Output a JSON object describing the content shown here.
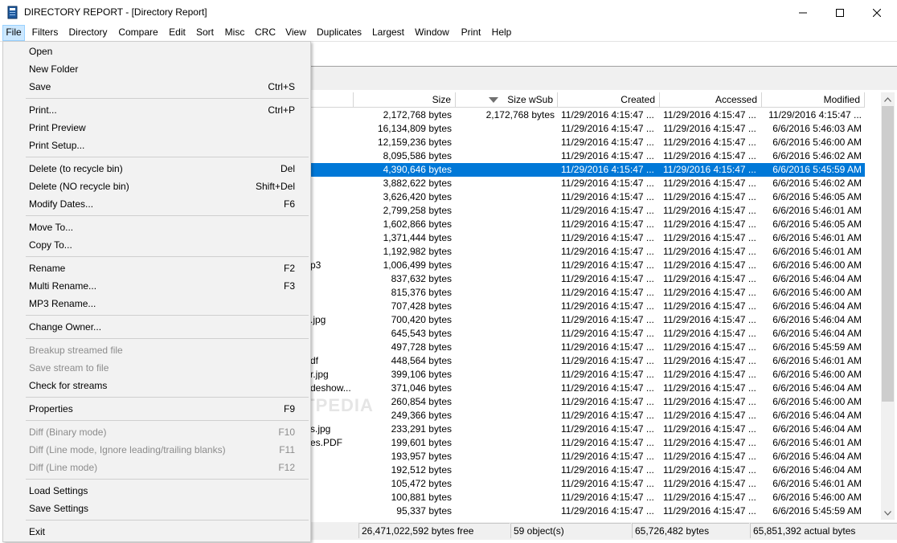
{
  "window": {
    "title": "DIRECTORY REPORT - [Directory Report]",
    "icons": {
      "app": "book-icon",
      "minimize": "minimize-icon",
      "maximize": "maximize-icon",
      "close": "close-icon"
    }
  },
  "menubar": {
    "items": [
      "File",
      "Filters",
      "Directory",
      "Compare",
      "Edit",
      "Sort",
      "Misc",
      "CRC",
      "View",
      "Duplicates",
      "Largest",
      "Window",
      "Print",
      "Help"
    ],
    "active": "File"
  },
  "file_menu": {
    "items": [
      {
        "label": "Open",
        "shortcut": "",
        "disabled": false
      },
      {
        "label": "New Folder",
        "shortcut": "",
        "disabled": false
      },
      {
        "label": "Save",
        "shortcut": "Ctrl+S",
        "disabled": false
      },
      {
        "label": "Print...",
        "shortcut": "Ctrl+P",
        "disabled": false
      },
      {
        "label": "Print Preview",
        "shortcut": "",
        "disabled": false
      },
      {
        "label": "Print Setup...",
        "shortcut": "",
        "disabled": false
      },
      {
        "label": "Delete (to recycle bin)",
        "shortcut": "Del",
        "disabled": false
      },
      {
        "label": "Delete  (NO recycle bin)",
        "shortcut": "Shift+Del",
        "disabled": false
      },
      {
        "label": "Modify Dates...",
        "shortcut": "F6",
        "disabled": false
      },
      {
        "label": "Move To...",
        "shortcut": "",
        "disabled": false
      },
      {
        "label": "Copy To...",
        "shortcut": "",
        "disabled": false
      },
      {
        "label": "Rename",
        "shortcut": "F2",
        "disabled": false
      },
      {
        "label": "Multi Rename...",
        "shortcut": "F3",
        "disabled": false
      },
      {
        "label": "MP3 Rename...",
        "shortcut": "",
        "disabled": false
      },
      {
        "label": "Change Owner...",
        "shortcut": "",
        "disabled": false
      },
      {
        "label": "Breakup streamed file",
        "shortcut": "",
        "disabled": true
      },
      {
        "label": "Save stream to file",
        "shortcut": "",
        "disabled": true
      },
      {
        "label": "Check for streams",
        "shortcut": "",
        "disabled": false
      },
      {
        "label": "Properties",
        "shortcut": "F9",
        "disabled": false
      },
      {
        "label": "Diff (Binary mode)",
        "shortcut": "F10",
        "disabled": true
      },
      {
        "label": "Diff (Line mode, Ignore leading/trailing blanks)",
        "shortcut": "F11",
        "disabled": true
      },
      {
        "label": "Diff (Line mode)",
        "shortcut": "F12",
        "disabled": true
      },
      {
        "label": "Load Settings",
        "shortcut": "",
        "disabled": false
      },
      {
        "label": "Save Settings",
        "shortcut": "",
        "disabled": false
      },
      {
        "label": "Exit",
        "shortcut": "",
        "disabled": false
      }
    ]
  },
  "list": {
    "columns": [
      "Size",
      "Size wSub",
      "Created",
      "Accessed",
      "Modified"
    ],
    "sort_icon": "sort-descending-icon",
    "rows": [
      {
        "name": "",
        "size": "2,172,768 bytes",
        "size_wsub": "2,172,768 bytes",
        "created": "11/29/2016 4:15:47 ...",
        "accessed": "11/29/2016 4:15:47 ...",
        "modified": "11/29/2016 4:15:47 ..."
      },
      {
        "name": "",
        "size": "16,134,809 bytes",
        "size_wsub": "",
        "created": "11/29/2016 4:15:47 ...",
        "accessed": "11/29/2016 4:15:47 ...",
        "modified": "6/6/2016 5:46:03 AM"
      },
      {
        "name": "",
        "size": "12,159,236 bytes",
        "size_wsub": "",
        "created": "11/29/2016 4:15:47 ...",
        "accessed": "11/29/2016 4:15:47 ...",
        "modified": "6/6/2016 5:46:00 AM"
      },
      {
        "name": "",
        "size": "8,095,586 bytes",
        "size_wsub": "",
        "created": "11/29/2016 4:15:47 ...",
        "accessed": "11/29/2016 4:15:47 ...",
        "modified": "6/6/2016 5:46:02 AM"
      },
      {
        "name": "",
        "size": "4,390,646 bytes",
        "size_wsub": "",
        "created": "11/29/2016 4:15:47 ...",
        "accessed": "11/29/2016 4:15:47 ...",
        "modified": "6/6/2016 5:45:59 AM",
        "selected": true
      },
      {
        "name": "",
        "size": "3,882,622 bytes",
        "size_wsub": "",
        "created": "11/29/2016 4:15:47 ...",
        "accessed": "11/29/2016 4:15:47 ...",
        "modified": "6/6/2016 5:46:02 AM"
      },
      {
        "name": "",
        "size": "3,626,420 bytes",
        "size_wsub": "",
        "created": "11/29/2016 4:15:47 ...",
        "accessed": "11/29/2016 4:15:47 ...",
        "modified": "6/6/2016 5:46:05 AM"
      },
      {
        "name": "",
        "size": "2,799,258 bytes",
        "size_wsub": "",
        "created": "11/29/2016 4:15:47 ...",
        "accessed": "11/29/2016 4:15:47 ...",
        "modified": "6/6/2016 5:46:01 AM"
      },
      {
        "name": "",
        "size": "1,602,866 bytes",
        "size_wsub": "",
        "created": "11/29/2016 4:15:47 ...",
        "accessed": "11/29/2016 4:15:47 ...",
        "modified": "6/6/2016 5:46:05 AM"
      },
      {
        "name": "",
        "size": "1,371,444 bytes",
        "size_wsub": "",
        "created": "11/29/2016 4:15:47 ...",
        "accessed": "11/29/2016 4:15:47 ...",
        "modified": "6/6/2016 5:46:01 AM"
      },
      {
        "name": "",
        "size": "1,192,982 bytes",
        "size_wsub": "",
        "created": "11/29/2016 4:15:47 ...",
        "accessed": "11/29/2016 4:15:47 ...",
        "modified": "6/6/2016 5:46:01 AM"
      },
      {
        "name": "p3",
        "size": "1,006,499 bytes",
        "size_wsub": "",
        "created": "11/29/2016 4:15:47 ...",
        "accessed": "11/29/2016 4:15:47 ...",
        "modified": "6/6/2016 5:46:00 AM"
      },
      {
        "name": "",
        "size": "837,632 bytes",
        "size_wsub": "",
        "created": "11/29/2016 4:15:47 ...",
        "accessed": "11/29/2016 4:15:47 ...",
        "modified": "6/6/2016 5:46:04 AM"
      },
      {
        "name": "",
        "size": "815,376 bytes",
        "size_wsub": "",
        "created": "11/29/2016 4:15:47 ...",
        "accessed": "11/29/2016 4:15:47 ...",
        "modified": "6/6/2016 5:46:00 AM"
      },
      {
        "name": "",
        "size": "707,428 bytes",
        "size_wsub": "",
        "created": "11/29/2016 4:15:47 ...",
        "accessed": "11/29/2016 4:15:47 ...",
        "modified": "6/6/2016 5:46:04 AM"
      },
      {
        "name": ".jpg",
        "size": "700,420 bytes",
        "size_wsub": "",
        "created": "11/29/2016 4:15:47 ...",
        "accessed": "11/29/2016 4:15:47 ...",
        "modified": "6/6/2016 5:46:04 AM"
      },
      {
        "name": "",
        "size": "645,543 bytes",
        "size_wsub": "",
        "created": "11/29/2016 4:15:47 ...",
        "accessed": "11/29/2016 4:15:47 ...",
        "modified": "6/6/2016 5:46:04 AM"
      },
      {
        "name": "",
        "size": "497,728 bytes",
        "size_wsub": "",
        "created": "11/29/2016 4:15:47 ...",
        "accessed": "11/29/2016 4:15:47 ...",
        "modified": "6/6/2016 5:45:59 AM"
      },
      {
        "name": "df",
        "size": "448,564 bytes",
        "size_wsub": "",
        "created": "11/29/2016 4:15:47 ...",
        "accessed": "11/29/2016 4:15:47 ...",
        "modified": "6/6/2016 5:46:01 AM"
      },
      {
        "name": "r.jpg",
        "size": "399,106 bytes",
        "size_wsub": "",
        "created": "11/29/2016 4:15:47 ...",
        "accessed": "11/29/2016 4:15:47 ...",
        "modified": "6/6/2016 5:46:00 AM"
      },
      {
        "name": "deshow...",
        "size": "371,046 bytes",
        "size_wsub": "",
        "created": "11/29/2016 4:15:47 ...",
        "accessed": "11/29/2016 4:15:47 ...",
        "modified": "6/6/2016 5:46:04 AM"
      },
      {
        "name": "",
        "size": "260,854 bytes",
        "size_wsub": "",
        "created": "11/29/2016 4:15:47 ...",
        "accessed": "11/29/2016 4:15:47 ...",
        "modified": "6/6/2016 5:46:00 AM"
      },
      {
        "name": "",
        "size": "249,366 bytes",
        "size_wsub": "",
        "created": "11/29/2016 4:15:47 ...",
        "accessed": "11/29/2016 4:15:47 ...",
        "modified": "6/6/2016 5:46:04 AM"
      },
      {
        "name": "s.jpg",
        "size": "233,291 bytes",
        "size_wsub": "",
        "created": "11/29/2016 4:15:47 ...",
        "accessed": "11/29/2016 4:15:47 ...",
        "modified": "6/6/2016 5:46:04 AM"
      },
      {
        "name": "es.PDF",
        "size": "199,601 bytes",
        "size_wsub": "",
        "created": "11/29/2016 4:15:47 ...",
        "accessed": "11/29/2016 4:15:47 ...",
        "modified": "6/6/2016 5:46:01 AM"
      },
      {
        "name": "",
        "size": "193,957 bytes",
        "size_wsub": "",
        "created": "11/29/2016 4:15:47 ...",
        "accessed": "11/29/2016 4:15:47 ...",
        "modified": "6/6/2016 5:46:04 AM"
      },
      {
        "name": "",
        "size": "192,512 bytes",
        "size_wsub": "",
        "created": "11/29/2016 4:15:47 ...",
        "accessed": "11/29/2016 4:15:47 ...",
        "modified": "6/6/2016 5:46:04 AM"
      },
      {
        "name": "",
        "size": "105,472 bytes",
        "size_wsub": "",
        "created": "11/29/2016 4:15:47 ...",
        "accessed": "11/29/2016 4:15:47 ...",
        "modified": "6/6/2016 5:46:01 AM"
      },
      {
        "name": "",
        "size": "100,881 bytes",
        "size_wsub": "",
        "created": "11/29/2016 4:15:47 ...",
        "accessed": "11/29/2016 4:15:47 ...",
        "modified": "6/6/2016 5:46:00 AM"
      },
      {
        "name": "",
        "size": "95,337 bytes",
        "size_wsub": "",
        "created": "11/29/2016 4:15:47 ...",
        "accessed": "11/29/2016 4:15:47 ...",
        "modified": "6/6/2016 5:45:59 AM"
      }
    ]
  },
  "statusbar": {
    "free": "26,471,022,592 bytes free",
    "objects": "59 object(s)",
    "bytes": "65,726,482 bytes",
    "actual": "65,851,392 actual bytes"
  },
  "watermark": "SOFTPEDIA",
  "colors": {
    "selection": "#0078d7",
    "menu_active": "#cce8ff",
    "menu_bg": "#f2f2f2",
    "disabled_text": "#8c8c8c"
  }
}
